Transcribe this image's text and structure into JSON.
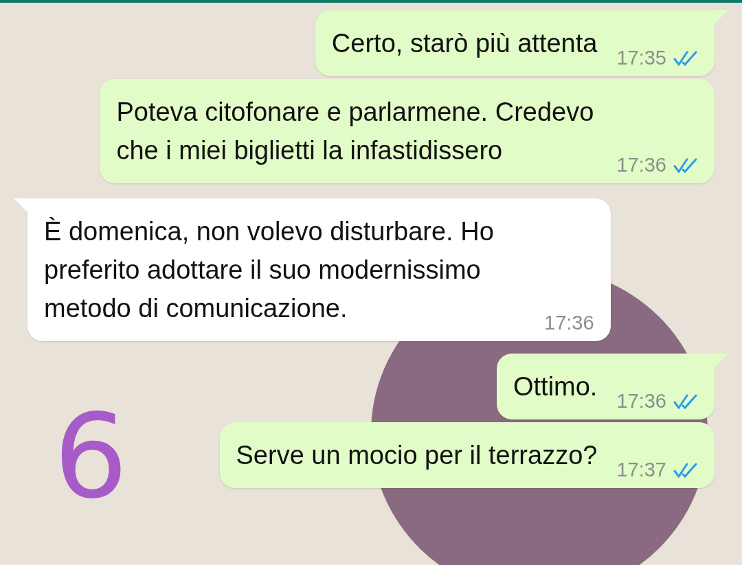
{
  "messages": [
    {
      "kind": "sent",
      "text": "Certo, starò più attenta",
      "time": "17:35",
      "read": true,
      "tail": true
    },
    {
      "kind": "sent",
      "text": "Poteva citofonare e parlarmene. Credevo che i miei biglietti la infastidissero",
      "time": "17:36",
      "read": true,
      "tail": false
    },
    {
      "kind": "received",
      "text": "È domenica, non volevo disturbare. Ho preferito adottare il suo modernissimo metodo di comunicazione.",
      "time": "17:36",
      "tail": true
    },
    {
      "kind": "sent",
      "text": "Ottimo.",
      "time": "17:36",
      "read": true,
      "tail": true
    },
    {
      "kind": "sent",
      "text": "Serve un mocio per il terrazzo?",
      "time": "17:37",
      "read": true,
      "tail": false
    }
  ],
  "annotation": "6"
}
